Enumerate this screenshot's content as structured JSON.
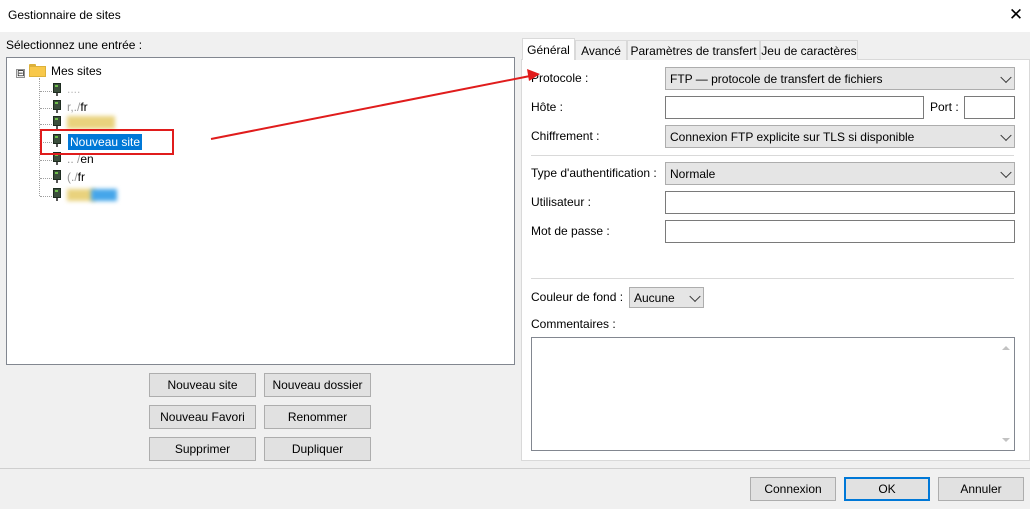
{
  "window": {
    "title": "Gestionnaire de sites",
    "close_glyph": "✕"
  },
  "left": {
    "select_label": "Sélectionnez une entrée :",
    "tree": {
      "root_label": "Mes sites",
      "expander_glyph": "⊟",
      "items": [
        {
          "label": "",
          "blur": "none"
        },
        {
          "label": "f",
          "blur": "none",
          "text2": "fr"
        },
        {
          "label": "",
          "blur": "yellow"
        },
        {
          "label": "Nouveau site",
          "selected": true
        },
        {
          "label": "n",
          "blur": "none",
          "text2": "en"
        },
        {
          "label": "",
          "blur": "none",
          "text2": "fr"
        },
        {
          "label": "",
          "blur": "blue"
        }
      ]
    },
    "buttons": {
      "new_site": "Nouveau site",
      "new_folder": "Nouveau dossier",
      "new_bookmark": "Nouveau Favori",
      "rename": "Renommer",
      "delete": "Supprimer",
      "duplicate": "Dupliquer"
    }
  },
  "tabs": [
    {
      "label": "Général",
      "active": true
    },
    {
      "label": "Avancé"
    },
    {
      "label": "Paramètres de transfert"
    },
    {
      "label": "Jeu de caractères"
    }
  ],
  "general": {
    "protocol_label": "Protocole :",
    "protocol_value": "FTP — protocole de transfert de fichiers",
    "host_label": "Hôte :",
    "host_value": "",
    "port_label": "Port :",
    "port_value": "",
    "encryption_label": "Chiffrement :",
    "encryption_value": "Connexion FTP explicite sur TLS si disponible",
    "auth_label": "Type d'authentification :",
    "auth_value": "Normale",
    "user_label": "Utilisateur :",
    "user_value": "",
    "password_label": "Mot de passe :",
    "password_value": "",
    "bg_label": "Couleur de fond :",
    "bg_value": "Aucune",
    "comments_label": "Commentaires :",
    "comments_value": ""
  },
  "footer": {
    "connect": "Connexion",
    "ok": "OK",
    "cancel": "Annuler"
  },
  "colors": {
    "selection": "#0078d7",
    "annotation_red": "#e01c1c"
  }
}
